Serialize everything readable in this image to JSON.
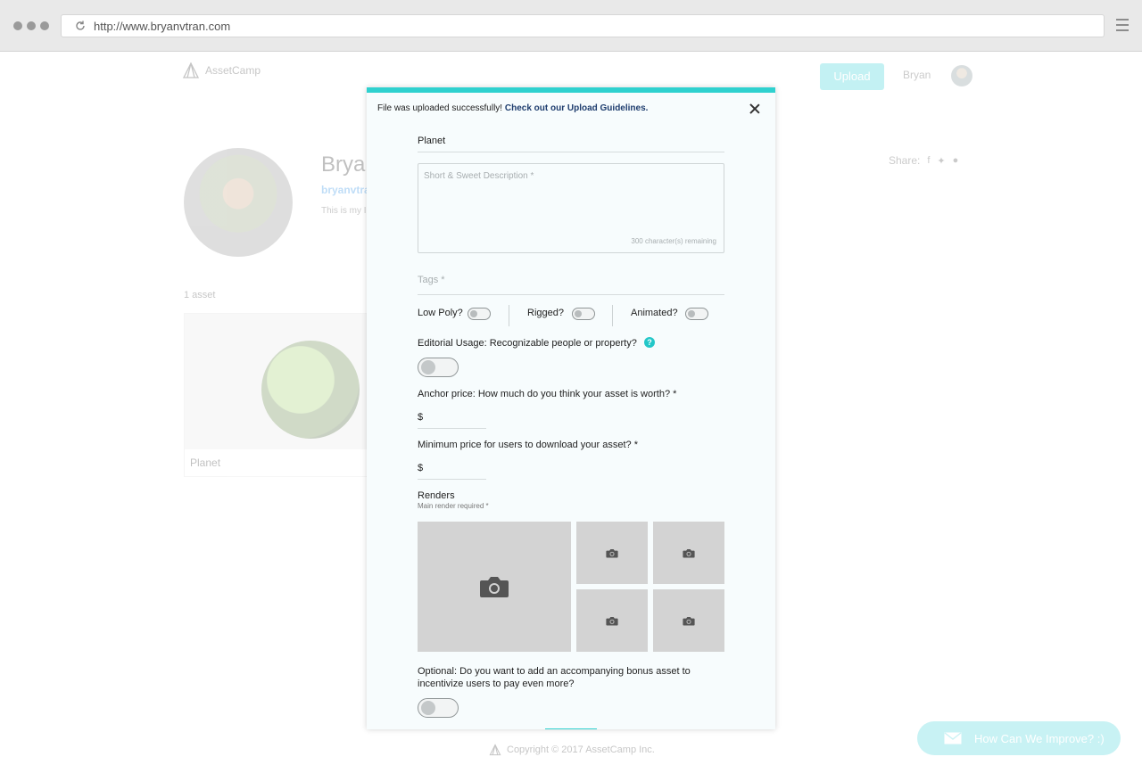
{
  "browser": {
    "url": "http://www.bryanvtran.com"
  },
  "site": {
    "brand": "AssetCamp",
    "upload_label": "Upload",
    "user_name": "Bryan",
    "copyright": "Copyright © 2017 AssetCamp Inc.",
    "feedback_label": "How Can We Improve? :)"
  },
  "profile": {
    "name": "Bryan",
    "handle": "bryanvtra",
    "bio": "This is my I",
    "share_label": "Share:",
    "asset_count": "1 asset",
    "asset_title": "Planet"
  },
  "modal": {
    "notice_text": "File was uploaded successfully!",
    "notice_link": "Check out our Upload Guidelines.",
    "title_value": "Planet",
    "description_placeholder": "Short & Sweet Description *",
    "chars_remaining": "300 character(s) remaining",
    "tags_placeholder": "Tags *",
    "low_poly_label": "Low Poly?",
    "rigged_label": "Rigged?",
    "animated_label": "Animated?",
    "editorial_label": "Editorial Usage: Recognizable people or property?",
    "help_glyph": "?",
    "anchor_label": "Anchor price: How much do you think your asset is worth? *",
    "anchor_currency": "$",
    "minimum_label": "Minimum price for users to download your asset? *",
    "minimum_currency": "$",
    "renders_label": "Renders",
    "renders_sub": "Main render required *",
    "bonus_label_line1": "Optional: Do you want to add an accompanying bonus asset to",
    "bonus_label_line2": "incentivize users to pay even more?"
  },
  "colors": {
    "accent": "#2fd1cf",
    "link": "#1e3d6e",
    "render_placeholder": "#d3d3d3"
  },
  "icons": {
    "reload": "reload-icon",
    "menu": "hamburger-icon",
    "close": "close-icon",
    "camera": "camera-icon",
    "mail": "mail-icon",
    "logo": "assetcamp-logo-icon"
  }
}
